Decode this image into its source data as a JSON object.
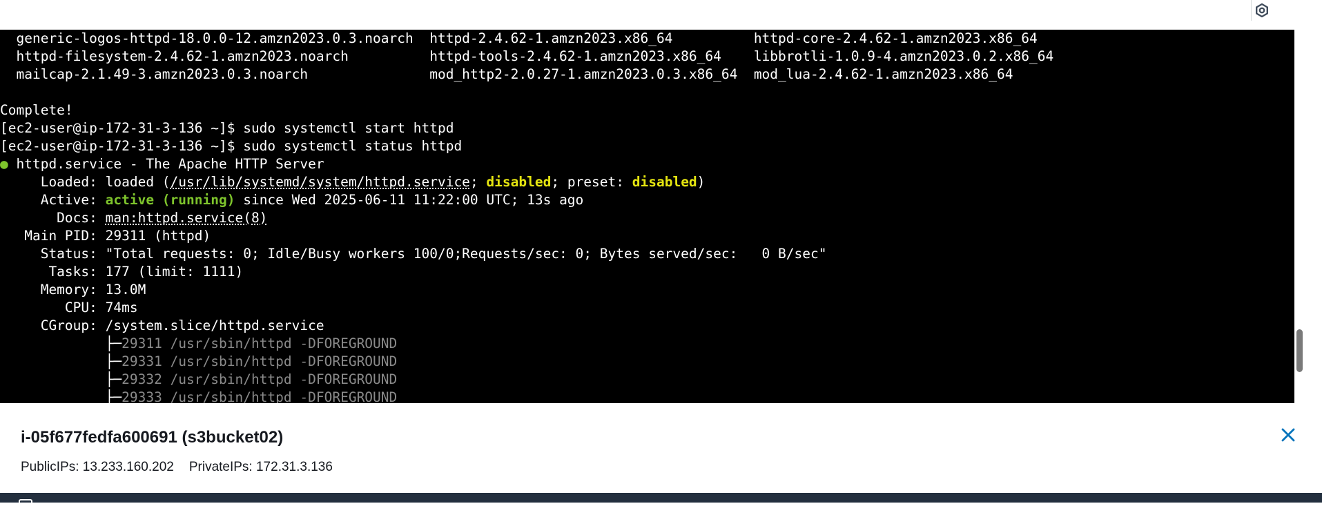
{
  "icons": {
    "settings": "settings-icon",
    "close": "close-icon"
  },
  "colors": {
    "terminal_bg": "#000000",
    "terminal_text": "#ffffff",
    "highlight_yellow": "#e5e510",
    "highlight_green": "#7ec42c",
    "accent_blue": "#0073bb"
  },
  "terminal": {
    "lines": [
      [
        {
          "t": "  generic-logos-httpd-18.0.0-12.amzn2023.0.3.noarch  httpd-2.4.62-1.amzn2023.x86_64          httpd-core-2.4.62-1.amzn2023.x86_64"
        }
      ],
      [
        {
          "t": "  httpd-filesystem-2.4.62-1.amzn2023.noarch          httpd-tools-2.4.62-1.amzn2023.x86_64    libbrotli-1.0.9-4.amzn2023.0.2.x86_64"
        }
      ],
      [
        {
          "t": "  mailcap-2.1.49-3.amzn2023.0.3.noarch               mod_http2-2.0.27-1.amzn2023.0.3.x86_64  mod_lua-2.4.62-1.amzn2023.x86_64"
        }
      ],
      [
        {
          "t": ""
        }
      ],
      [
        {
          "t": "Complete!"
        }
      ],
      [
        {
          "t": "[ec2-user@ip-172-31-3-136 ~]$ sudo systemctl start httpd"
        }
      ],
      [
        {
          "t": "[ec2-user@ip-172-31-3-136 ~]$ sudo systemctl status httpd"
        }
      ],
      [
        {
          "t": "●",
          "c": "green"
        },
        {
          "t": " httpd.service - The Apache HTTP Server"
        }
      ],
      [
        {
          "t": "     Loaded: loaded ("
        },
        {
          "t": "/usr/lib/systemd/system/httpd.service",
          "c": "underline"
        },
        {
          "t": "; "
        },
        {
          "t": "disabled",
          "c": "yellow"
        },
        {
          "t": "; preset: "
        },
        {
          "t": "disabled",
          "c": "yellow"
        },
        {
          "t": ")"
        }
      ],
      [
        {
          "t": "     Active: "
        },
        {
          "t": "active (running)",
          "c": "green"
        },
        {
          "t": " since Wed 2025-06-11 11:22:00 UTC; 13s ago"
        }
      ],
      [
        {
          "t": "       Docs: "
        },
        {
          "t": "man:httpd.service(8)",
          "c": "underline"
        }
      ],
      [
        {
          "t": "   Main PID: 29311 (httpd)"
        }
      ],
      [
        {
          "t": "     Status: \"Total requests: 0; Idle/Busy workers 100/0;Requests/sec: 0; Bytes served/sec:   0 B/sec\""
        }
      ],
      [
        {
          "t": "      Tasks: 177 (limit: 1111)"
        }
      ],
      [
        {
          "t": "     Memory: 13.0M"
        }
      ],
      [
        {
          "t": "        CPU: 74ms"
        }
      ],
      [
        {
          "t": "     CGroup: /system.slice/httpd.service"
        }
      ],
      [
        {
          "t": "             ├─",
          "c": "tree"
        },
        {
          "t": "29311 /usr/sbin/httpd -DFOREGROUND",
          "c": "dim"
        }
      ],
      [
        {
          "t": "             ├─",
          "c": "tree"
        },
        {
          "t": "29331 /usr/sbin/httpd -DFOREGROUND",
          "c": "dim"
        }
      ],
      [
        {
          "t": "             ├─",
          "c": "tree"
        },
        {
          "t": "29332 /usr/sbin/httpd -DFOREGROUND",
          "c": "dim"
        }
      ],
      [
        {
          "t": "             ├─",
          "c": "tree"
        },
        {
          "t": "29333 /usr/sbin/httpd -DFOREGROUND",
          "c": "dim"
        }
      ]
    ]
  },
  "instance": {
    "title": "i-05f677fedfa600691 (s3bucket02)",
    "public_ips": "PublicIPs: 13.233.160.202",
    "private_ips": "PrivateIPs: 172.31.3.136"
  }
}
